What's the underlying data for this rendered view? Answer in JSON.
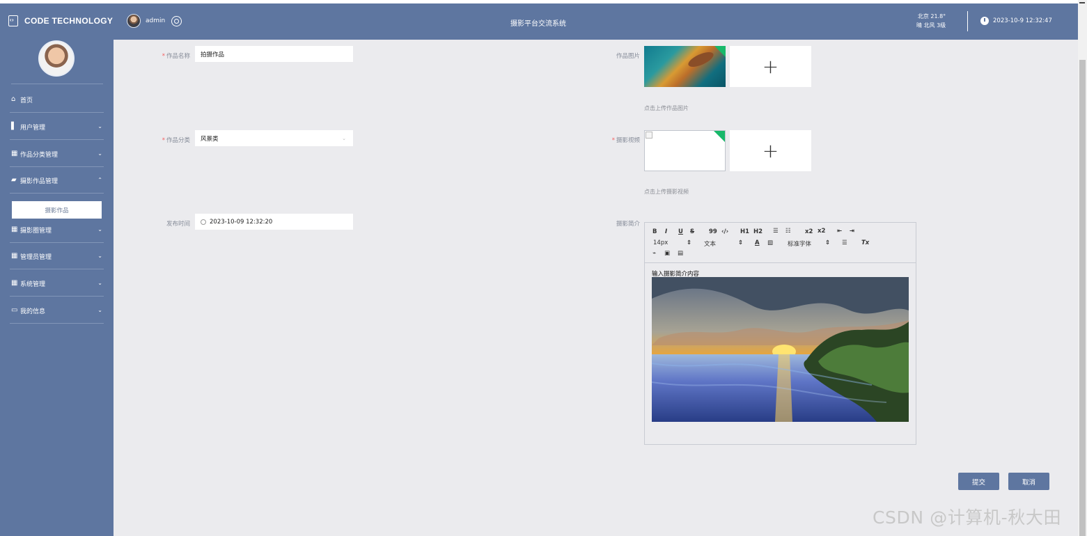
{
  "header": {
    "brand": "CODE TECHNOLOGY",
    "user": "admin",
    "system_title": "摄影平台交流系统",
    "weather_line1": "北京 21.8°",
    "weather_line2": "晴 北风 3级",
    "datetime": "2023-10-9 12:32:47"
  },
  "sidebar": {
    "items": [
      {
        "label": "首页",
        "icon": "home-icon"
      },
      {
        "label": "用户管理",
        "icon": "bar-chart-icon"
      },
      {
        "label": "作品分类管理",
        "icon": "grid-icon"
      },
      {
        "label": "摄影作品管理",
        "icon": "comment-icon"
      },
      {
        "label": "摄影圈管理",
        "icon": "grid-icon"
      },
      {
        "label": "管理员管理",
        "icon": "grid-icon"
      },
      {
        "label": "系统管理",
        "icon": "table-icon"
      },
      {
        "label": "我的信息",
        "icon": "profile-card-icon"
      }
    ],
    "submenu_item": "摄影作品"
  },
  "form": {
    "work_name_label": "作品名称",
    "work_name_value": "拍摄作品",
    "category_label": "作品分类",
    "category_value": "风景类",
    "publish_time_label": "发布时间",
    "publish_time_value": "2023-10-09 12:32:20",
    "work_image_label": "作品图片",
    "work_image_hint": "点击上传作品图片",
    "video_label": "摄影视频",
    "video_hint": "点击上传摄影视频",
    "intro_label": "摄影简介",
    "editor": {
      "font_size": "14px",
      "text_type": "文本",
      "font_family": "标准字体",
      "content": "输入摄影简介内容",
      "bold": "B",
      "italic": "I",
      "underline": "U",
      "strike": "S",
      "quote": "99",
      "code": "‹/›",
      "h1": "H1",
      "h2": "H2",
      "subscript": "x2",
      "superscript": "x2",
      "font_color": "A",
      "clear_format": "Tx"
    },
    "submit": "提交",
    "cancel": "取消"
  },
  "watermark": "CSDN @计算机-秋大田",
  "colors": {
    "primary": "#5e76a0",
    "background": "#ebebee",
    "upload_success": "#18b86a"
  }
}
